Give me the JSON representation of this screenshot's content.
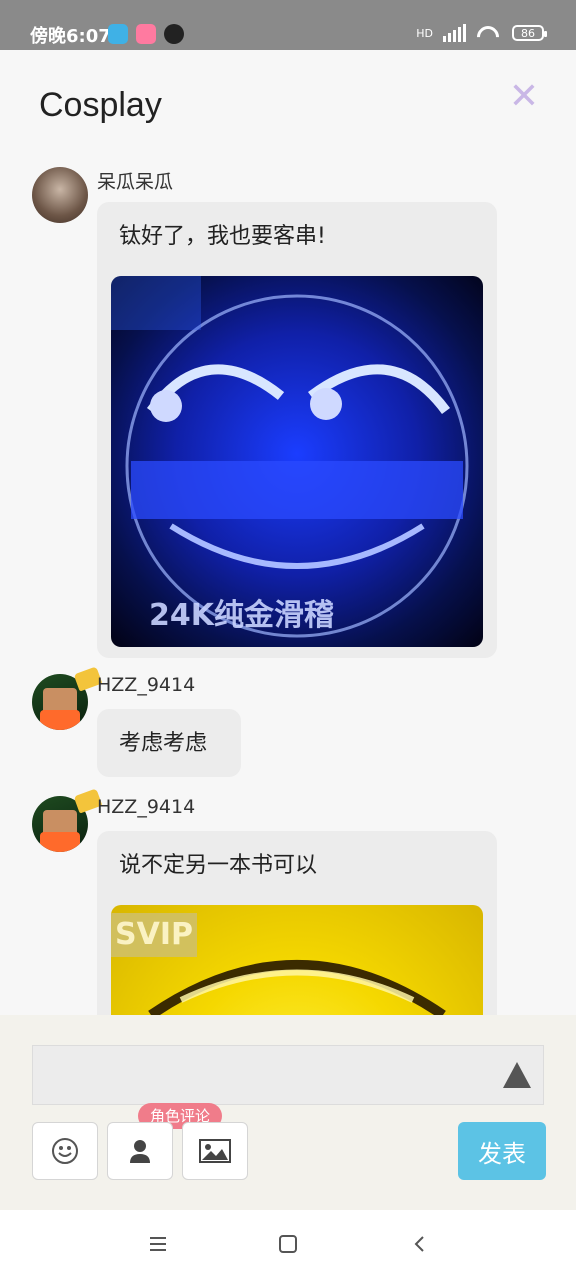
{
  "status": {
    "time": "傍晚6:07",
    "battery": "86",
    "network_label": "HD"
  },
  "header": {
    "title": "Cosplay",
    "close_icon": "close-icon"
  },
  "messages": [
    {
      "username": "呆瓜呆瓜",
      "text": "钛好了，我也要客串!",
      "image_caption": "24K纯金滑稽"
    },
    {
      "username": "HZZ_9414",
      "text": "考虑考虑"
    },
    {
      "username": "HZZ_9414",
      "text": "说不定另一本书可以",
      "image_caption": "SVIP"
    }
  ],
  "composer": {
    "input_value": "",
    "role_tag": "角色评论",
    "post_label": "发表"
  },
  "colors": {
    "accent": "#5cc3e5",
    "tag": "#f07c8a",
    "close": "#c9b7e6"
  }
}
